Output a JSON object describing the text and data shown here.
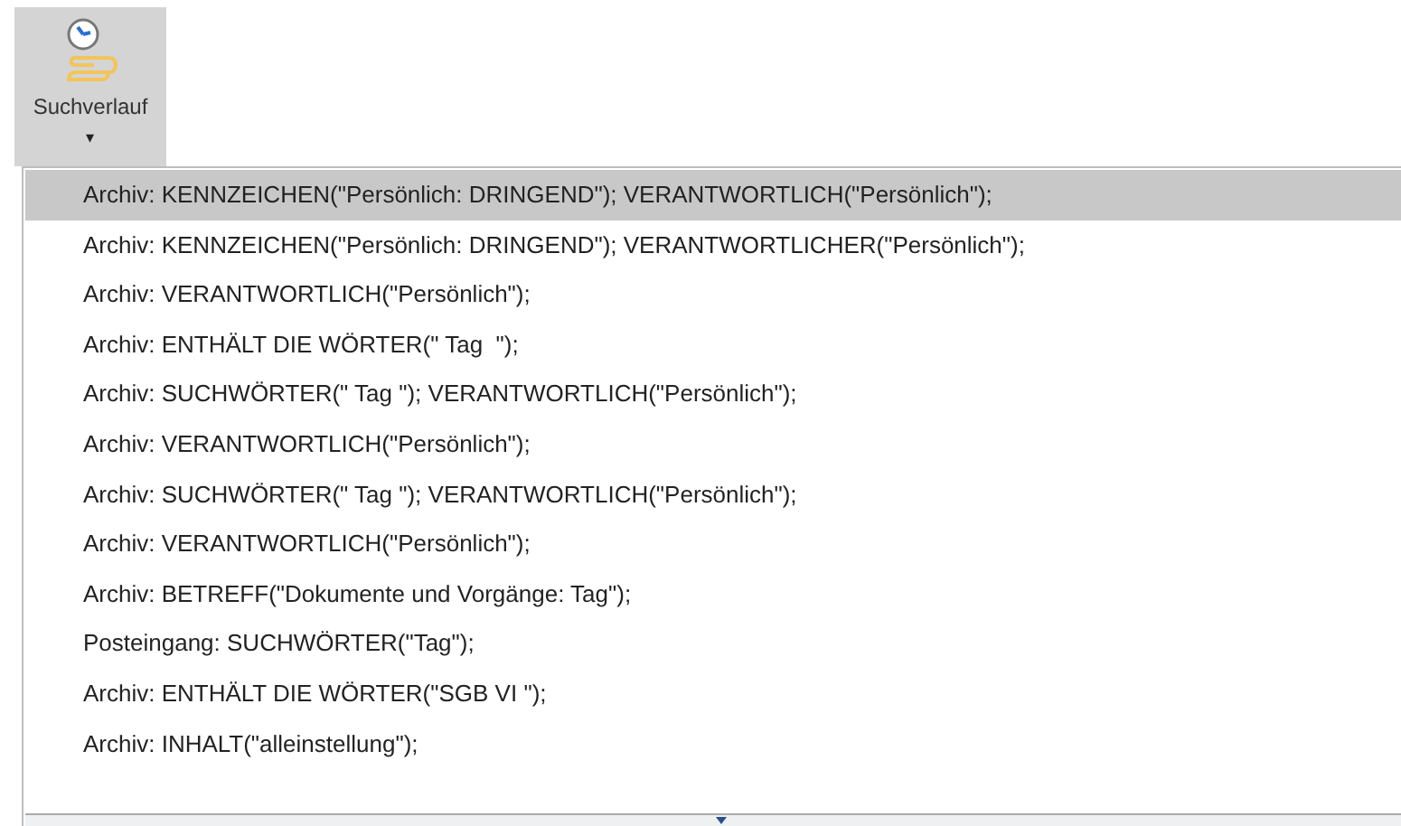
{
  "ribbon_button": {
    "label": "Suchverlauf",
    "caret": "▾"
  },
  "history_list": {
    "items": [
      {
        "text": "Archiv: KENNZEICHEN(\"Persönlich: DRINGEND\"); VERANTWORTLICH(\"Persönlich\");",
        "selected": true
      },
      {
        "text": "Archiv: KENNZEICHEN(\"Persönlich: DRINGEND\"); VERANTWORTLICHER(\"Persönlich\");",
        "selected": false
      },
      {
        "text": "Archiv: VERANTWORTLICH(\"Persönlich\");",
        "selected": false
      },
      {
        "text": "Archiv: ENTHÄLT DIE WÖRTER(\" Tag  \");",
        "selected": false
      },
      {
        "text": "Archiv: SUCHWÖRTER(\" Tag \"); VERANTWORTLICH(\"Persönlich\");",
        "selected": false
      },
      {
        "text": "Archiv: VERANTWORTLICH(\"Persönlich\");",
        "selected": false
      },
      {
        "text": "Archiv: SUCHWÖRTER(\" Tag \"); VERANTWORTLICH(\"Persönlich\");",
        "selected": false
      },
      {
        "text": "Archiv: VERANTWORTLICH(\"Persönlich\");",
        "selected": false
      },
      {
        "text": "Archiv: BETREFF(\"Dokumente und Vorgänge: Tag\");",
        "selected": false
      },
      {
        "text": "Posteingang: SUCHWÖRTER(\"Tag\");",
        "selected": false
      },
      {
        "text": "Archiv: ENTHÄLT DIE WÖRTER(\"SGB VI \");",
        "selected": false
      },
      {
        "text": "Archiv: INHALT(\"alleinstellung\");",
        "selected": false
      }
    ]
  }
}
